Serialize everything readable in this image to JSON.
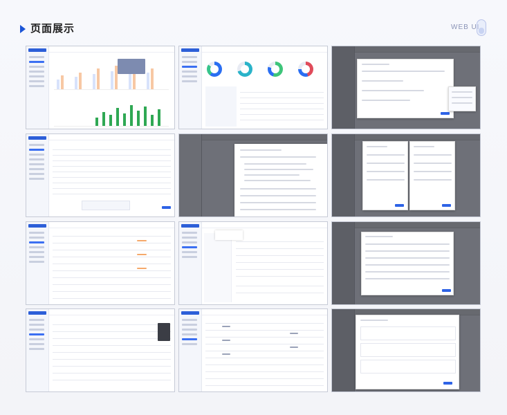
{
  "header": {
    "title": "页面展示",
    "subtitle": "WEB UI"
  },
  "colors": {
    "accent": "#1b55d6",
    "frame": "#c6cad6",
    "dark_overlay": "#6e7078"
  },
  "thumbnails": [
    {
      "id": "dashboard-charts"
    },
    {
      "id": "dashboard-donuts"
    },
    {
      "id": "modal-calendar"
    },
    {
      "id": "table-list"
    },
    {
      "id": "tree-panel"
    },
    {
      "id": "modal-form-double"
    },
    {
      "id": "table-list-2"
    },
    {
      "id": "tree-detail"
    },
    {
      "id": "modal-table"
    },
    {
      "id": "table-tags"
    },
    {
      "id": "table-chips"
    },
    {
      "id": "modal-cards"
    }
  ]
}
